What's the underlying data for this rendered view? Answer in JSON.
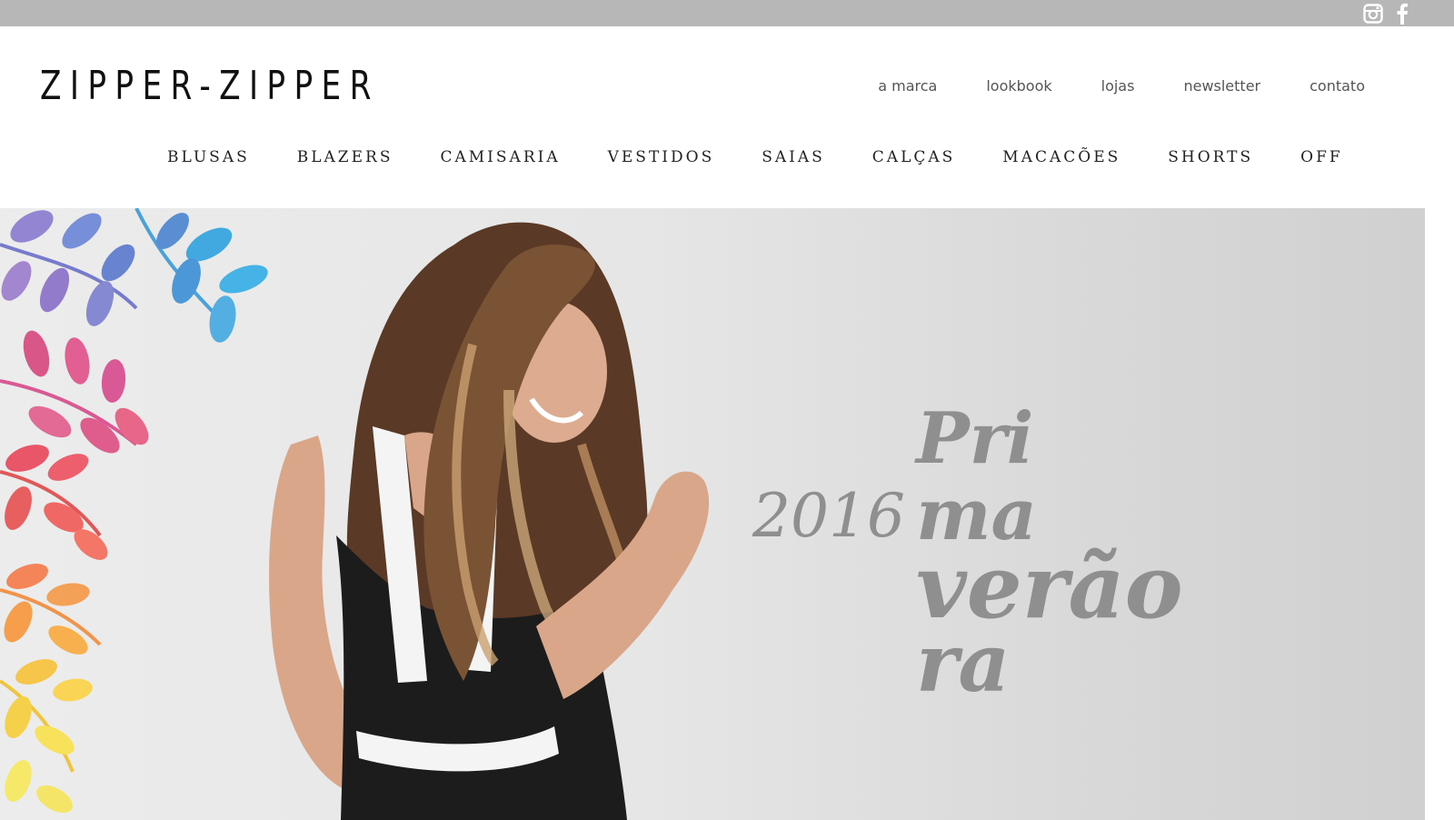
{
  "topbar": {
    "icons": [
      "instagram-icon",
      "facebook-icon"
    ]
  },
  "header": {
    "logo": "ZIPPER-ZIPPER",
    "top_nav": [
      "a marca",
      "lookbook",
      "lojas",
      "newsletter",
      "contato"
    ],
    "categories": [
      "BLUSAS",
      "BLAZERS",
      "CAMISARIA",
      "VESTIDOS",
      "SAIAS",
      "CALÇAS",
      "MACACÕES",
      "SHORTS",
      "OFF"
    ]
  },
  "hero": {
    "year": "2016",
    "lines": [
      "Pri",
      "ma",
      "verão",
      "ra"
    ]
  },
  "colors": {
    "topbar": "#b7b7b7",
    "hero_text": "#8f8f8f",
    "logo": "#111111"
  }
}
